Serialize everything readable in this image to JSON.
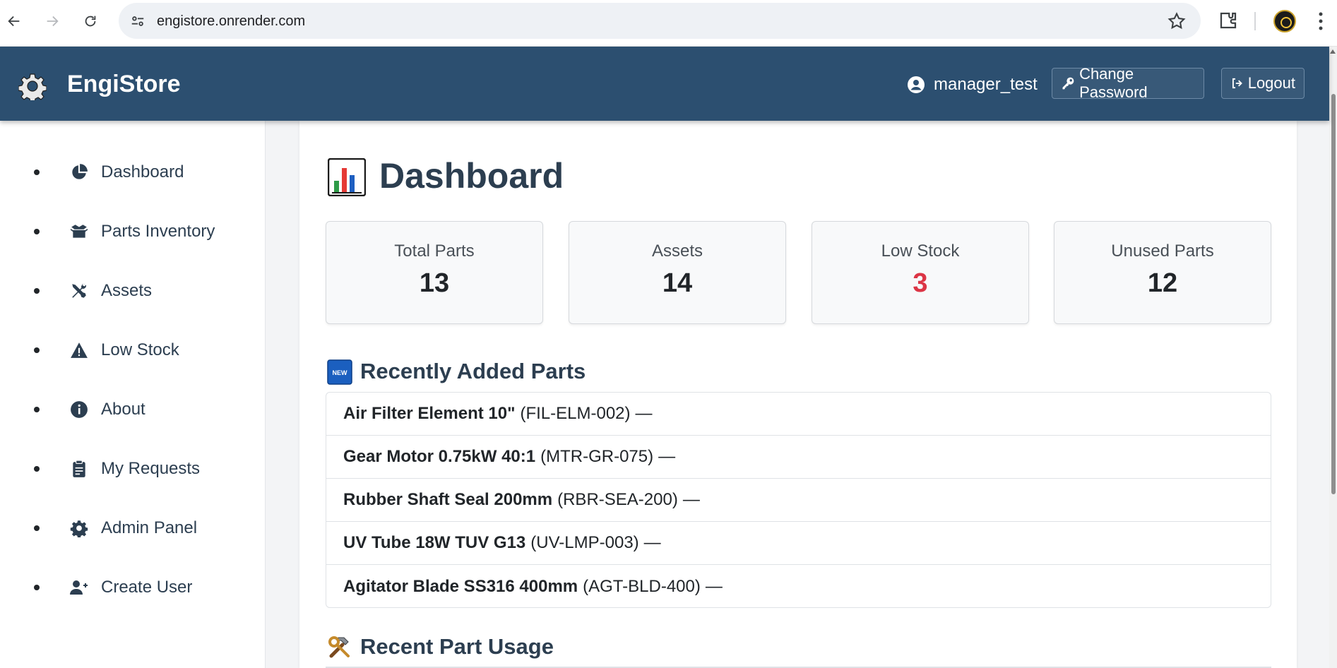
{
  "browser": {
    "url": "engistore.onrender.com"
  },
  "header": {
    "brand": "EngiStore",
    "username": "manager_test",
    "change_password_label": "Change Password",
    "logout_label": "Logout"
  },
  "sidebar": {
    "items": [
      {
        "label": "Dashboard",
        "icon": "pie-chart-icon"
      },
      {
        "label": "Parts Inventory",
        "icon": "box-open-icon"
      },
      {
        "label": "Assets",
        "icon": "tools-icon"
      },
      {
        "label": "Low Stock",
        "icon": "warning-icon"
      },
      {
        "label": "About",
        "icon": "info-icon"
      },
      {
        "label": "My Requests",
        "icon": "clipboard-icon"
      },
      {
        "label": "Admin Panel",
        "icon": "gear-icon"
      },
      {
        "label": "Create User",
        "icon": "user-plus-icon"
      }
    ]
  },
  "main": {
    "title": "Dashboard",
    "stats": [
      {
        "label": "Total Parts",
        "value": "13"
      },
      {
        "label": "Assets",
        "value": "14"
      },
      {
        "label": "Low Stock",
        "value": "3"
      },
      {
        "label": "Unused Parts",
        "value": "12"
      }
    ],
    "recent_parts_title": "Recently Added Parts",
    "recent_parts": [
      {
        "name": "Air Filter Element 10\"",
        "code": "(FIL-ELM-002)",
        "suffix": "—"
      },
      {
        "name": "Gear Motor 0.75kW 40:1",
        "code": "(MTR-GR-075)",
        "suffix": "—"
      },
      {
        "name": "Rubber Shaft Seal 200mm",
        "code": "(RBR-SEA-200)",
        "suffix": "—"
      },
      {
        "name": "UV Tube 18W TUV G13",
        "code": "(UV-LMP-003)",
        "suffix": "—"
      },
      {
        "name": "Agitator Blade SS316 400mm",
        "code": "(AGT-BLD-400)",
        "suffix": "—"
      }
    ],
    "recent_usage_title": "Recent Part Usage"
  },
  "colors": {
    "header_bg": "#2c4f70",
    "text_dark": "#2c3e50",
    "low_stock_value": "#dc3545"
  }
}
